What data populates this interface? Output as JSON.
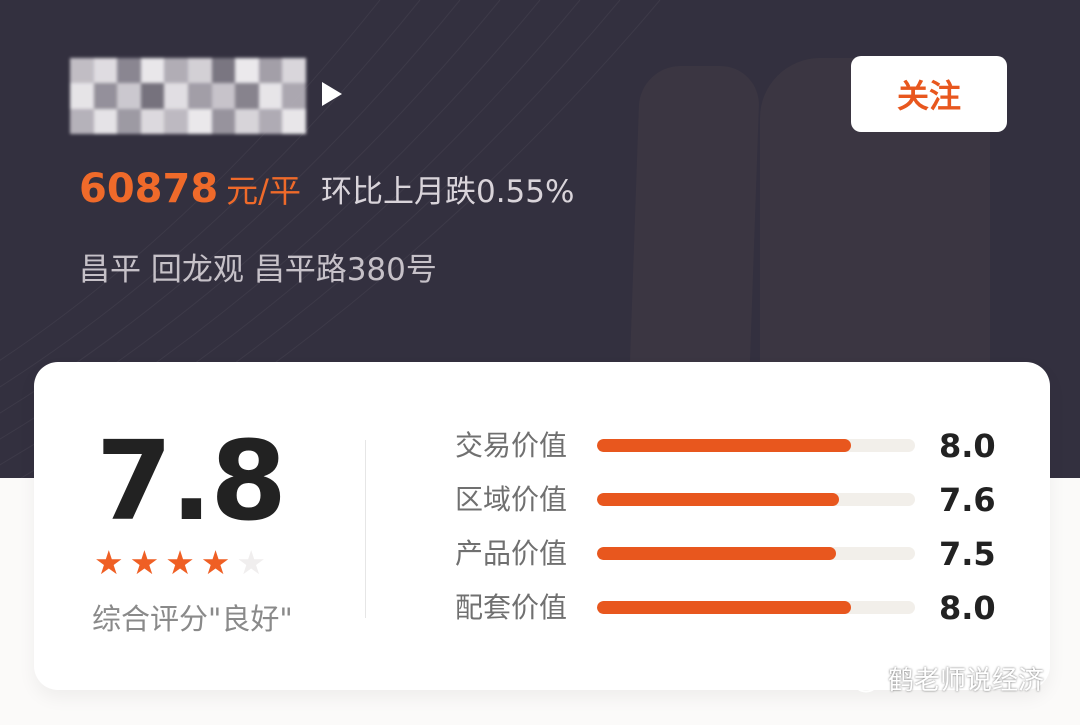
{
  "header": {
    "follow_label": "关注",
    "price_value": "60878",
    "price_unit": "元/平",
    "price_change": "环比上月跌0.55%",
    "address": "昌平 回龙观 昌平路380号"
  },
  "rating": {
    "score": "7.8",
    "stars_filled": 4,
    "stars_total": 5,
    "label": "综合评分\"良好\"",
    "metrics": [
      {
        "label": "交易价值",
        "value": "8.0",
        "fill": 0.8
      },
      {
        "label": "区域价值",
        "value": "7.6",
        "fill": 0.76
      },
      {
        "label": "产品价值",
        "value": "7.5",
        "fill": 0.75
      },
      {
        "label": "配套价值",
        "value": "8.0",
        "fill": 0.8
      }
    ]
  },
  "watermark": {
    "text": "鹤老师说经济"
  },
  "colors": {
    "accent": "#e8571e",
    "hero_bg": "#33303f",
    "card_bg": "#ffffff",
    "star_off": "#f0eeee"
  },
  "icons": {
    "name_arrow": "right-triangle-icon",
    "star": "star-icon",
    "watermark_logo": "wechat-icon"
  }
}
